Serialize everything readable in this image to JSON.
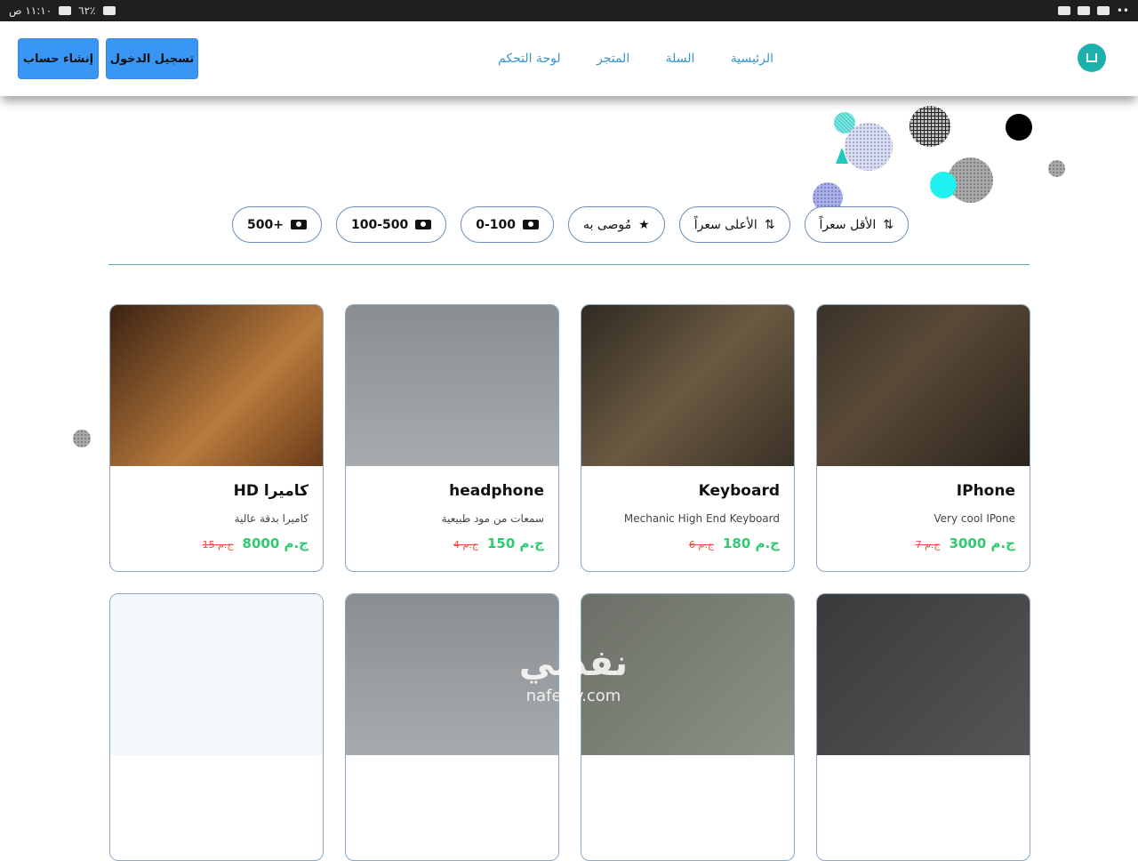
{
  "status_bar": {
    "time": "١١:١٠ ص",
    "battery": "٦٢٪",
    "dots": "••"
  },
  "navbar": {
    "register_label": "إنشاء حساب",
    "login_label": "تسجيل الدخول",
    "links": [
      "الرئيسية",
      "السلة",
      "المتجر",
      "لوحة التحكم"
    ]
  },
  "filters": [
    {
      "label": "الأقل سعراً",
      "icon": "sort-ascending-icon"
    },
    {
      "label": "الأعلى سعراً",
      "icon": "sort-descending-icon"
    },
    {
      "label": "مُوصى به",
      "icon": "star-icon"
    },
    {
      "label": "0-100",
      "icon": "cash-icon"
    },
    {
      "label": "100-500",
      "icon": "cash-icon"
    },
    {
      "label": "+500",
      "icon": "cash-icon"
    }
  ],
  "products": [
    {
      "title": "IPhone",
      "desc": "Very cool IPone",
      "price": "ج.م 3000",
      "old": "ج.م 7",
      "image": "phone-photo"
    },
    {
      "title": "Keyboard",
      "desc": "Mechanic High End Keyboard",
      "price": "ج.م 180",
      "old": "ج.م 6",
      "image": "keyboard-photo"
    },
    {
      "title": "headphone",
      "desc": "سمعات من مود طبيعية",
      "price": "ج.م 150",
      "old": "ج.م 4",
      "image": "headphone-photo"
    },
    {
      "title": "كاميرا HD",
      "desc": "كاميرا بدقة عالية",
      "price": "ج.م 8000",
      "old": "ج.م 15",
      "image": "camera-photo"
    },
    {
      "title": "",
      "desc": "",
      "price": "",
      "old": "",
      "image": "airpods-photo"
    },
    {
      "title": "",
      "desc": "",
      "price": "",
      "old": "",
      "image": "watch-photo"
    },
    {
      "title": "",
      "desc": "",
      "price": "",
      "old": "",
      "image": "headphone-photo"
    },
    {
      "title": "",
      "desc": "",
      "price": "",
      "old": "",
      "image": "sale-illustration"
    }
  ],
  "watermark": {
    "text": "نفذلي",
    "sub": "nafezly.com"
  },
  "colors": {
    "primary": "#3a96f5",
    "link": "#3a96c8",
    "price_new": "#2ecc71",
    "price_old": "#e74c3c",
    "teal": "#1db0ad"
  }
}
